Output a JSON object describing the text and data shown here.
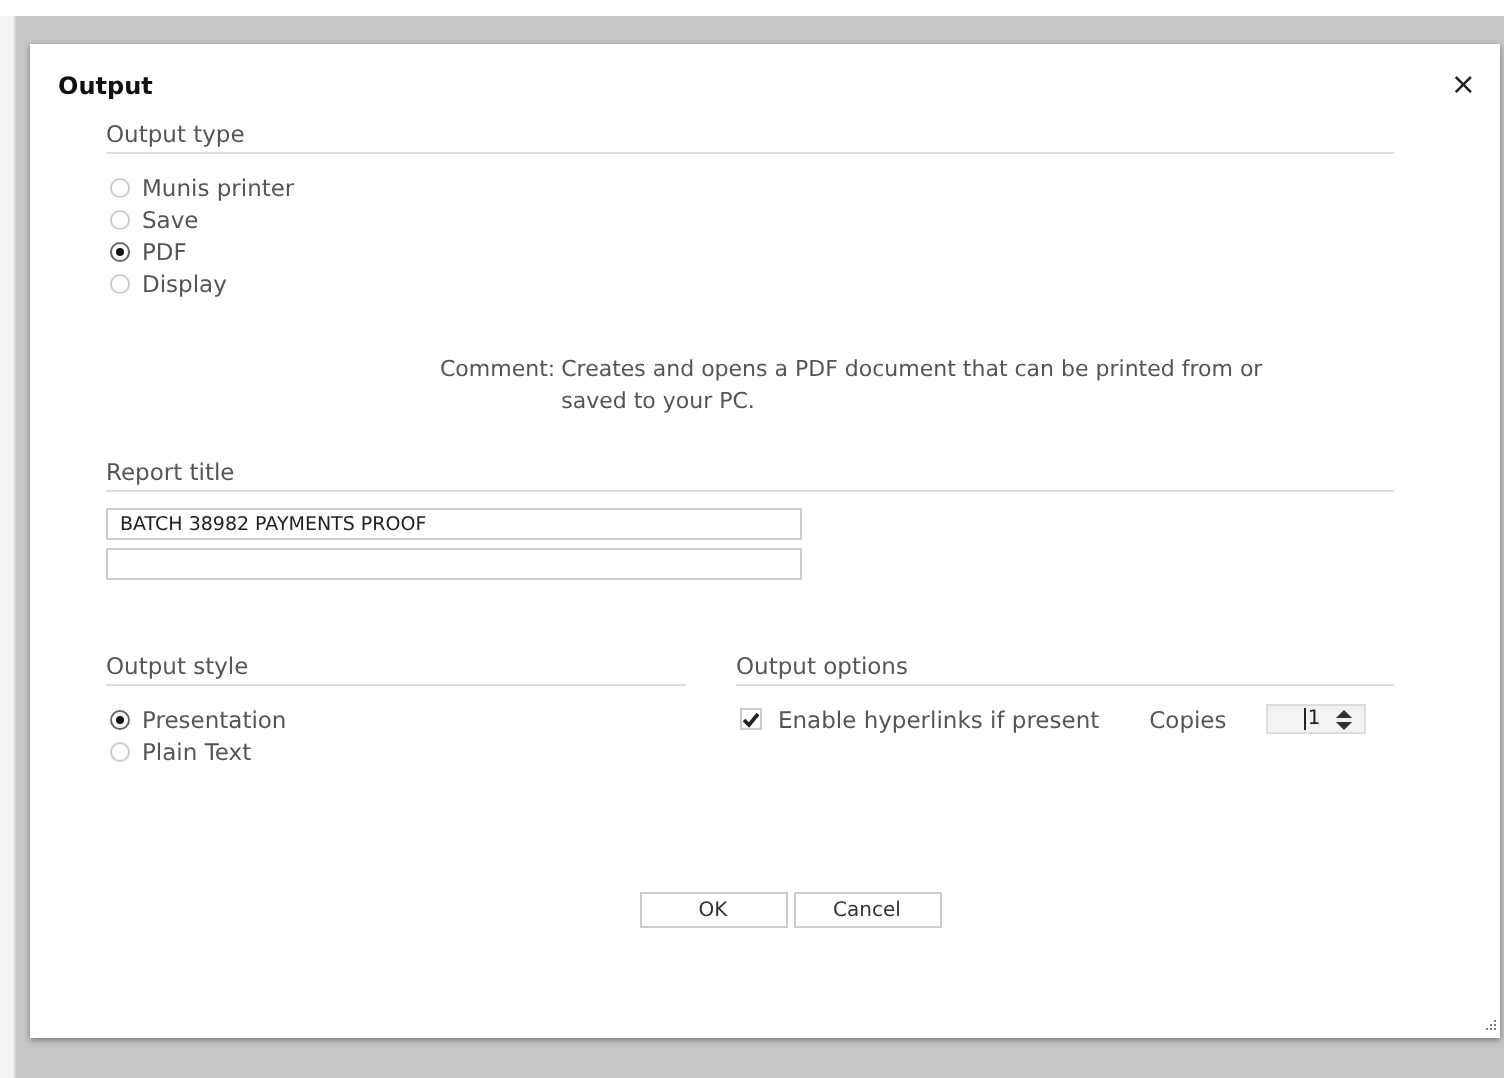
{
  "dialog": {
    "title": "Output",
    "close": "×"
  },
  "output_type": {
    "heading": "Output type",
    "options": [
      {
        "label": "Munis printer",
        "selected": false
      },
      {
        "label": "Save",
        "selected": false
      },
      {
        "label": "PDF",
        "selected": true
      },
      {
        "label": "Display",
        "selected": false
      }
    ]
  },
  "comment": {
    "label": "Comment:",
    "text": "Creates and opens a PDF document that can be printed from or saved to your PC."
  },
  "report_title": {
    "heading": "Report title",
    "fields": [
      {
        "kind": "filled",
        "value": "BATCH 38982 PAYMENTS PROOF"
      },
      {
        "kind": "empty"
      }
    ]
  },
  "output_style": {
    "heading": "Output style",
    "options": [
      {
        "label": "Presentation",
        "selected": true
      },
      {
        "label": "Plain Text",
        "selected": false
      }
    ]
  },
  "output_options": {
    "heading": "Output options",
    "hyperlinks": {
      "label": "Enable hyperlinks if present",
      "checked": true
    },
    "copies": {
      "label": "Copies",
      "value": "1"
    }
  },
  "buttons": [
    "OK",
    "Cancel"
  ]
}
